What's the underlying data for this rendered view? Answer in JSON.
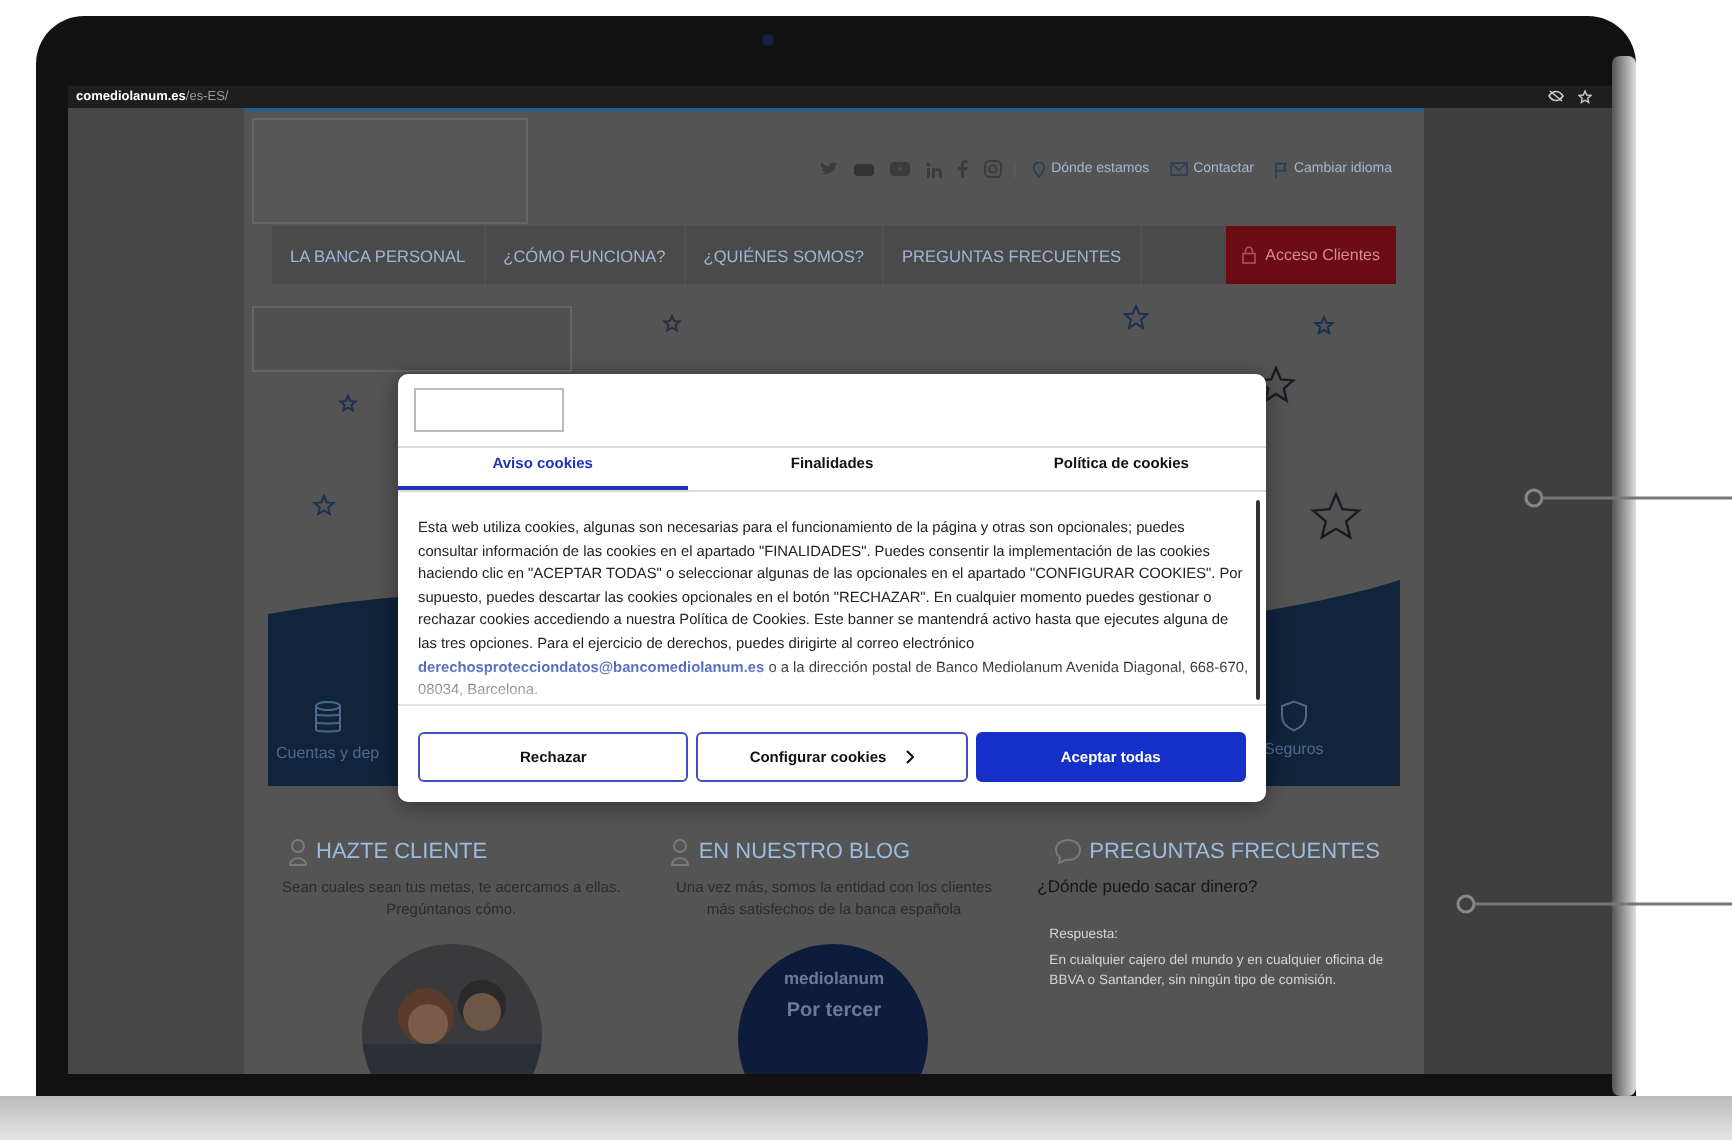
{
  "browser": {
    "url_domain": "comediolanum.es",
    "url_path": "/es-ES/"
  },
  "header_links": [
    {
      "label": "Dónde estamos",
      "kind": "pin"
    },
    {
      "label": "Contactar",
      "kind": "mail"
    },
    {
      "label": "Cambiar idioma",
      "kind": "flag"
    }
  ],
  "nav": {
    "items": [
      "LA BANCA PERSONAL",
      "¿CÓMO FUNCIONA?",
      "¿QUIÉNES SOMOS?",
      "PREGUNTAS FRECUENTES"
    ],
    "login_button": "Acceso Clientes"
  },
  "hero": {
    "products": [
      {
        "label": "Cuentas y dep",
        "kind": "coins"
      },
      {
        "label": "Seguros",
        "kind": "shield"
      }
    ]
  },
  "sections": [
    {
      "title": "HAZTE CLIENTE",
      "text": "Sean cuales sean tus metas, te acercamos a ellas. Pregúntanos cómo."
    },
    {
      "kind": "promo",
      "title": "EN NUESTRO BLOG",
      "text": "Una vez más, somos la entidad con los clientes más satisfechos de la banca española",
      "promo_brand": "mediolanum",
      "promo_text": "Por tercer"
    },
    {
      "kind": "faq",
      "title": "PREGUNTAS FRECUENTES",
      "question": "¿Dónde puedo sacar dinero?",
      "answer_label": "Respuesta:",
      "answer": "En cualquier cajero del mundo y en cualquier oficina de BBVA o Santander, sin ningún tipo de comisión."
    }
  ],
  "cookie_dialog": {
    "tabs": [
      {
        "label": "Aviso cookies",
        "selected": true
      },
      {
        "label": "Finalidades",
        "selected": false
      },
      {
        "label": "Política de cookies",
        "selected": false
      }
    ],
    "body": "Esta web utiliza cookies, algunas son necesarias para el funcionamiento de la página y otras son opcionales; puedes consultar información de las cookies en el apartado \"FINALIDADES\". Puedes consentir la implementación de las cookies haciendo clic en \"ACEPTAR TODAS\" o seleccionar algunas de las opcionales en el apartado \"CONFIGURAR COOKIES\". Por supuesto, puedes descartar las cookies opcionales en el botón \"RECHAZAR\". En cualquier momento puedes gestionar o rechazar cookies accediendo a nuestra Política de Cookies. Este banner se mantendrá activo hasta que ejecutes alguna de las tres opciones. Para el ejercicio de derechos, puedes dirigirte al correo electrónico",
    "link": "derechosprotecciondatos@bancomediolanum.es",
    "body_after": "o a la dirección postal de Banco Mediolanum Avenida Diagonal, 668-670, 08034, Barcelona.",
    "buttons": [
      {
        "label": "Rechazar",
        "kind": "outline"
      },
      {
        "label": "Configurar cookies",
        "kind": "outline-next"
      },
      {
        "label": "Aceptar todas",
        "kind": "primary"
      }
    ]
  }
}
